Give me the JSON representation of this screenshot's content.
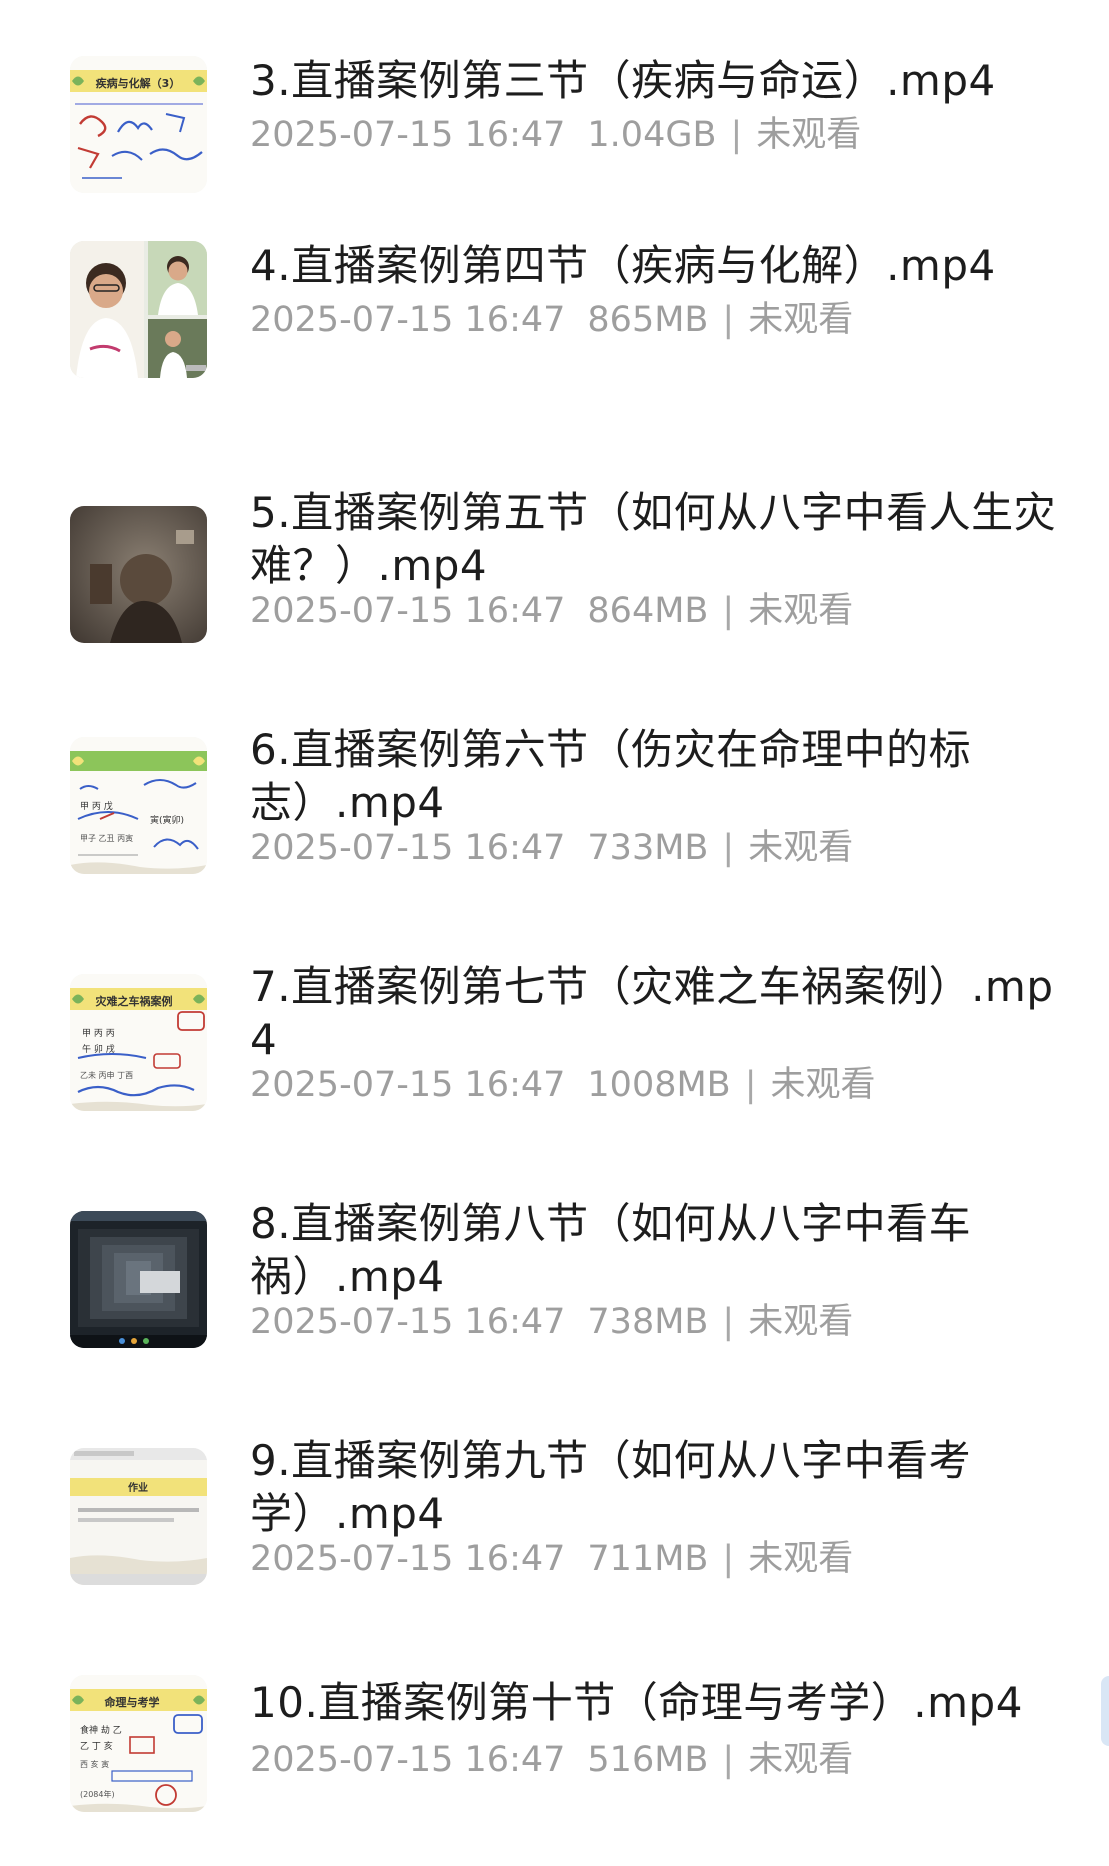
{
  "files": [
    {
      "title": "3.直播案例第三节（疾病与命运）.mp4",
      "date": "2025-07-15 16:47",
      "size": "1.04GB",
      "status": "未观看",
      "thumb_label": "疾病与化解（3）",
      "thumb_icon": "whiteboard-notes-thumbnail"
    },
    {
      "title": "4.直播案例第四节（疾病与化解）.mp4",
      "date": "2025-07-15 16:47",
      "size": "865MB",
      "status": "未观看",
      "thumb_label": "",
      "thumb_icon": "person-photo-collage-thumbnail"
    },
    {
      "title": "5.直播案例第五节（如何从八字中看人生灾难？）.mp4",
      "date": "2025-07-15 16:47",
      "size": "864MB",
      "status": "未观看",
      "thumb_label": "",
      "thumb_icon": "dark-room-video-thumbnail"
    },
    {
      "title": "6.直播案例第六节（伤灾在命理中的标志）.mp4",
      "date": "2025-07-15 16:47",
      "size": "733MB",
      "status": "未观看",
      "thumb_label": "",
      "thumb_icon": "whiteboard-notes-thumbnail"
    },
    {
      "title": "7.直播案例第七节（灾难之车祸案例）.mp4",
      "date": "2025-07-15 16:47",
      "size": "1008MB",
      "status": "未观看",
      "thumb_label": "灾难之车祸案例",
      "thumb_icon": "whiteboard-notes-thumbnail"
    },
    {
      "title": "8.直播案例第八节（如何从八字中看车祸）.mp4",
      "date": "2025-07-15 16:47",
      "size": "738MB",
      "status": "未观看",
      "thumb_label": "",
      "thumb_icon": "desktop-screenshot-thumbnail"
    },
    {
      "title": "9.直播案例第九节（如何从八字中看考学）.mp4",
      "date": "2025-07-15 16:47",
      "size": "711MB",
      "status": "未观看",
      "thumb_label": "作业",
      "thumb_icon": "slide-document-thumbnail"
    },
    {
      "title": "10.直播案例第十节（命理与考学）.mp4",
      "date": "2025-07-15 16:47",
      "size": "516MB",
      "status": "未观看",
      "thumb_label": "命理与考学",
      "thumb_icon": "whiteboard-notes-thumbnail"
    }
  ],
  "meta_separator": "|",
  "colors": {
    "title": "#1d1d1d",
    "meta": "#9e9e9e",
    "banner_yellow": "#f2e27a",
    "banner_green": "#8cc55a",
    "ink_blue": "#3a5fc8",
    "ink_red": "#d2423a"
  }
}
